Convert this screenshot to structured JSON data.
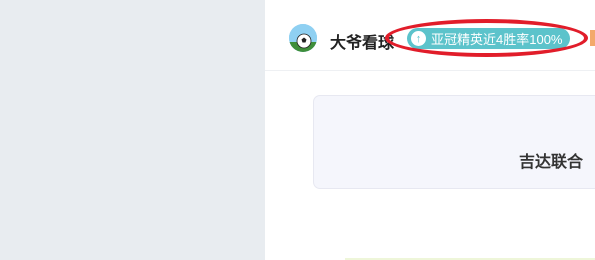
{
  "author": {
    "name": "大爷看球",
    "avatar_icon": "soccer-ball-avatar"
  },
  "badge": {
    "icon": "arrow-up-icon",
    "text": "亚冠精英近4胜率100%",
    "color": "#5cc3cb"
  },
  "match": {
    "team": "吉达联合"
  },
  "colors": {
    "highlight": "#e11d2a",
    "left_panel": "#e8ecf0"
  }
}
